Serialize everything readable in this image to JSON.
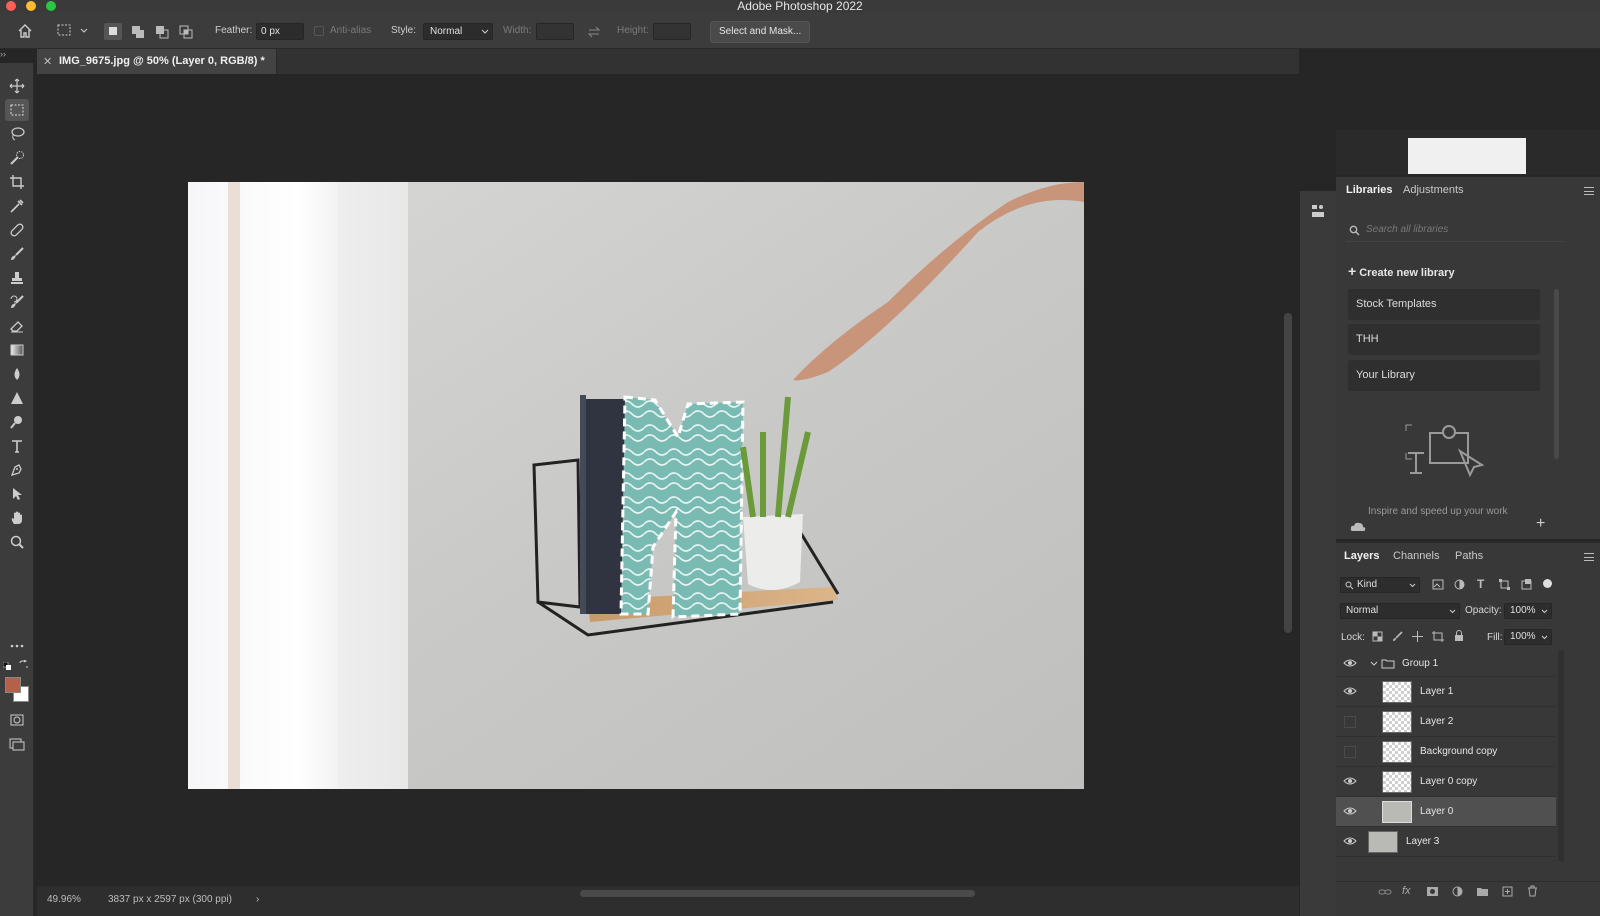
{
  "window": {
    "title": "Adobe Photoshop 2022"
  },
  "options_bar": {
    "feather_label": "Feather:",
    "feather_value": "0 px",
    "antialias_label": "Anti-alias",
    "style_label": "Style:",
    "style_value": "Normal",
    "width_label": "Width:",
    "height_label": "Height:",
    "select_mask_button": "Select and Mask..."
  },
  "document": {
    "tab_title": "IMG_9675.jpg @ 50% (Layer 0, RGB/8) *"
  },
  "tools": [
    "move-tool",
    "marquee-tool",
    "lasso-tool",
    "quick-select-tool",
    "crop-tool",
    "eyedropper-tool",
    "spot-healing-tool",
    "brush-tool",
    "clone-stamp-tool",
    "history-brush-tool",
    "eraser-tool",
    "gradient-tool",
    "blur-tool",
    "dodge-tool",
    "pen-tool",
    "type-tool",
    "path-select-tool",
    "hand-tool",
    "zoom-tool"
  ],
  "colors": {
    "foreground": "#b5614a",
    "background": "#ffffff",
    "accent": "#7fbdb6"
  },
  "libraries_panel": {
    "tabs": [
      "Libraries",
      "Adjustments"
    ],
    "search_placeholder": "Search all libraries",
    "create_label": "Create new library",
    "items": [
      "Stock Templates",
      "THH",
      "Your Library"
    ],
    "hint": "Inspire and speed up your work"
  },
  "layers_panel": {
    "tabs": [
      "Layers",
      "Channels",
      "Paths"
    ],
    "filter_label": "Kind",
    "blend_mode": "Normal",
    "opacity_label": "Opacity:",
    "opacity_value": "100%",
    "lock_label": "Lock:",
    "fill_label": "Fill:",
    "fill_value": "100%",
    "group_name": "Group 1",
    "layers": [
      {
        "name": "Layer 1",
        "visible": true
      },
      {
        "name": "Layer 2",
        "visible": false
      },
      {
        "name": "Background copy",
        "visible": false
      },
      {
        "name": "Layer 0 copy",
        "visible": true
      },
      {
        "name": "Layer 0",
        "visible": true,
        "selected": true
      },
      {
        "name": "Layer 3",
        "visible": true
      }
    ]
  },
  "status_bar": {
    "zoom": "49.96%",
    "doc_info": "3837 px x 2597 px (300 ppi)",
    "arrow": "›"
  }
}
